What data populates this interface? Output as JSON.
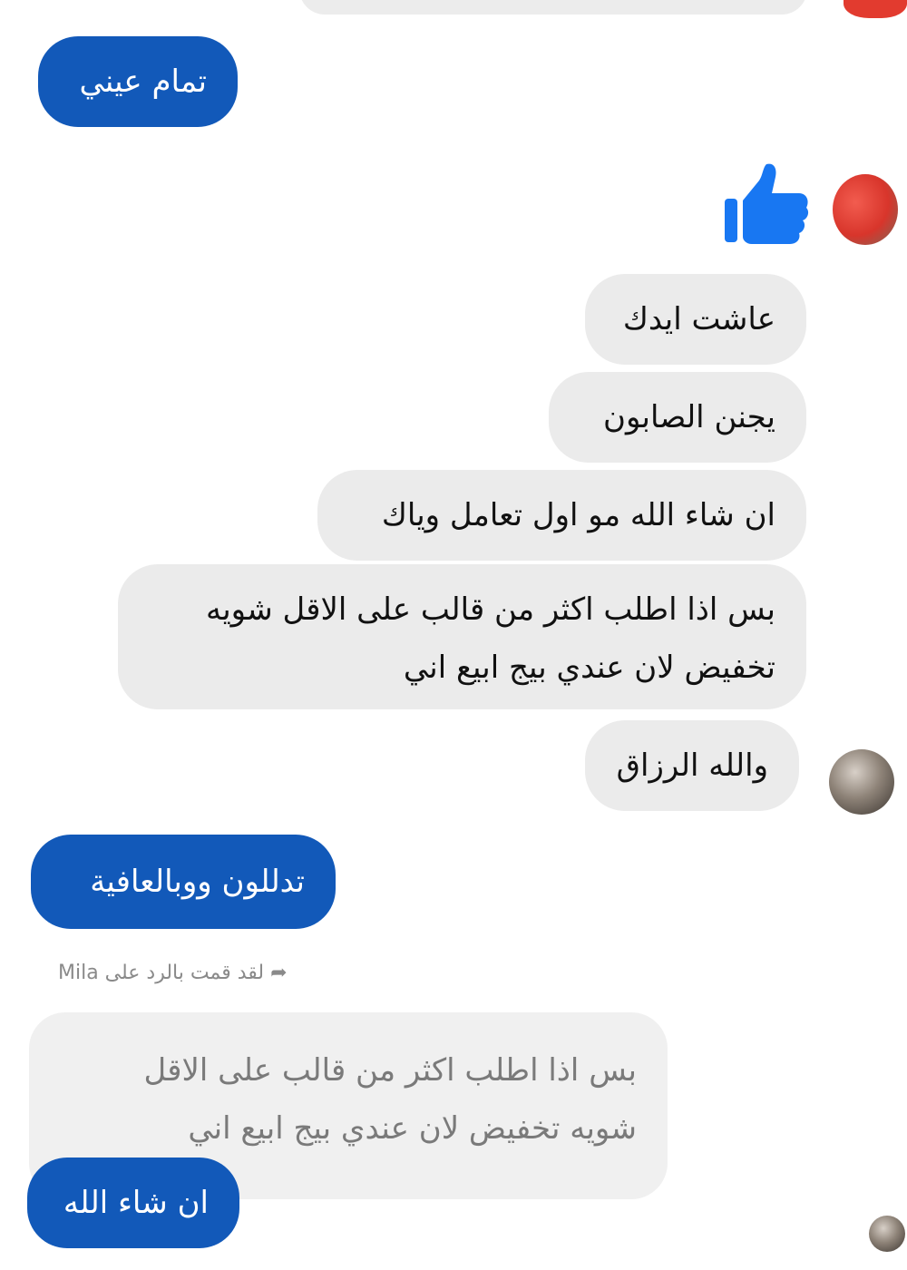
{
  "messages": {
    "sent_1": "تمام عيني",
    "recv_1": "عاشت ايدك",
    "recv_2": "يجنن الصابون",
    "recv_3": "ان شاء الله مو اول تعامل وياك",
    "recv_4_line1": "بس اذا اطلب اكثر من قالب على الاقل شويه",
    "recv_4_line2": "تخفيض لان عندي بيج ابيع اني",
    "recv_5": "والله الرزاق",
    "sent_2": "تدللون ووبالعافية",
    "reply_note": "لقد قمت بالرد على Mila",
    "quoted_line1": "بس اذا اطلب اكثر من قالب على الاقل",
    "quoted_line2": "شويه تخفيض لان عندي بيج ابيع اني",
    "sent_3": "ان شاء الله"
  },
  "icons": {
    "like": "thumbs-up-icon",
    "reply": "reply-arrow-icon"
  },
  "colors": {
    "sent_bubble": "#1259b9",
    "received_bubble": "#ebebeb",
    "like_icon": "#1877f2"
  }
}
